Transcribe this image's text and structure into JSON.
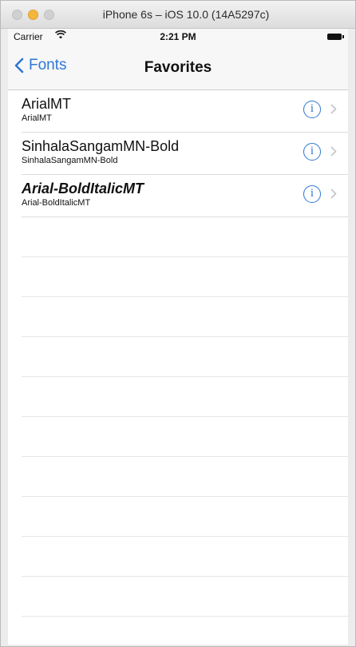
{
  "window": {
    "title": "iPhone 6s – iOS 10.0 (14A5297c)"
  },
  "status_bar": {
    "carrier": "Carrier",
    "time": "2:21 PM"
  },
  "nav": {
    "back_label": "Fonts",
    "title": "Favorites"
  },
  "fonts": [
    {
      "name": "ArialMT",
      "postscript": "ArialMT"
    },
    {
      "name": "SinhalaSangamMN-Bold",
      "postscript": "SinhalaSangamMN-Bold"
    },
    {
      "name": "Arial-BoldItalicMT",
      "postscript": "Arial-BoldItalicMT"
    }
  ],
  "icons": {
    "info": "i",
    "wifi": "wifi-icon",
    "battery": "battery-icon",
    "back": "chevron-left-icon",
    "disclosure": "chevron-right-icon"
  },
  "colors": {
    "tint": "#2f77d6",
    "background": "#ffffff",
    "navbar": "#f7f7f7"
  }
}
